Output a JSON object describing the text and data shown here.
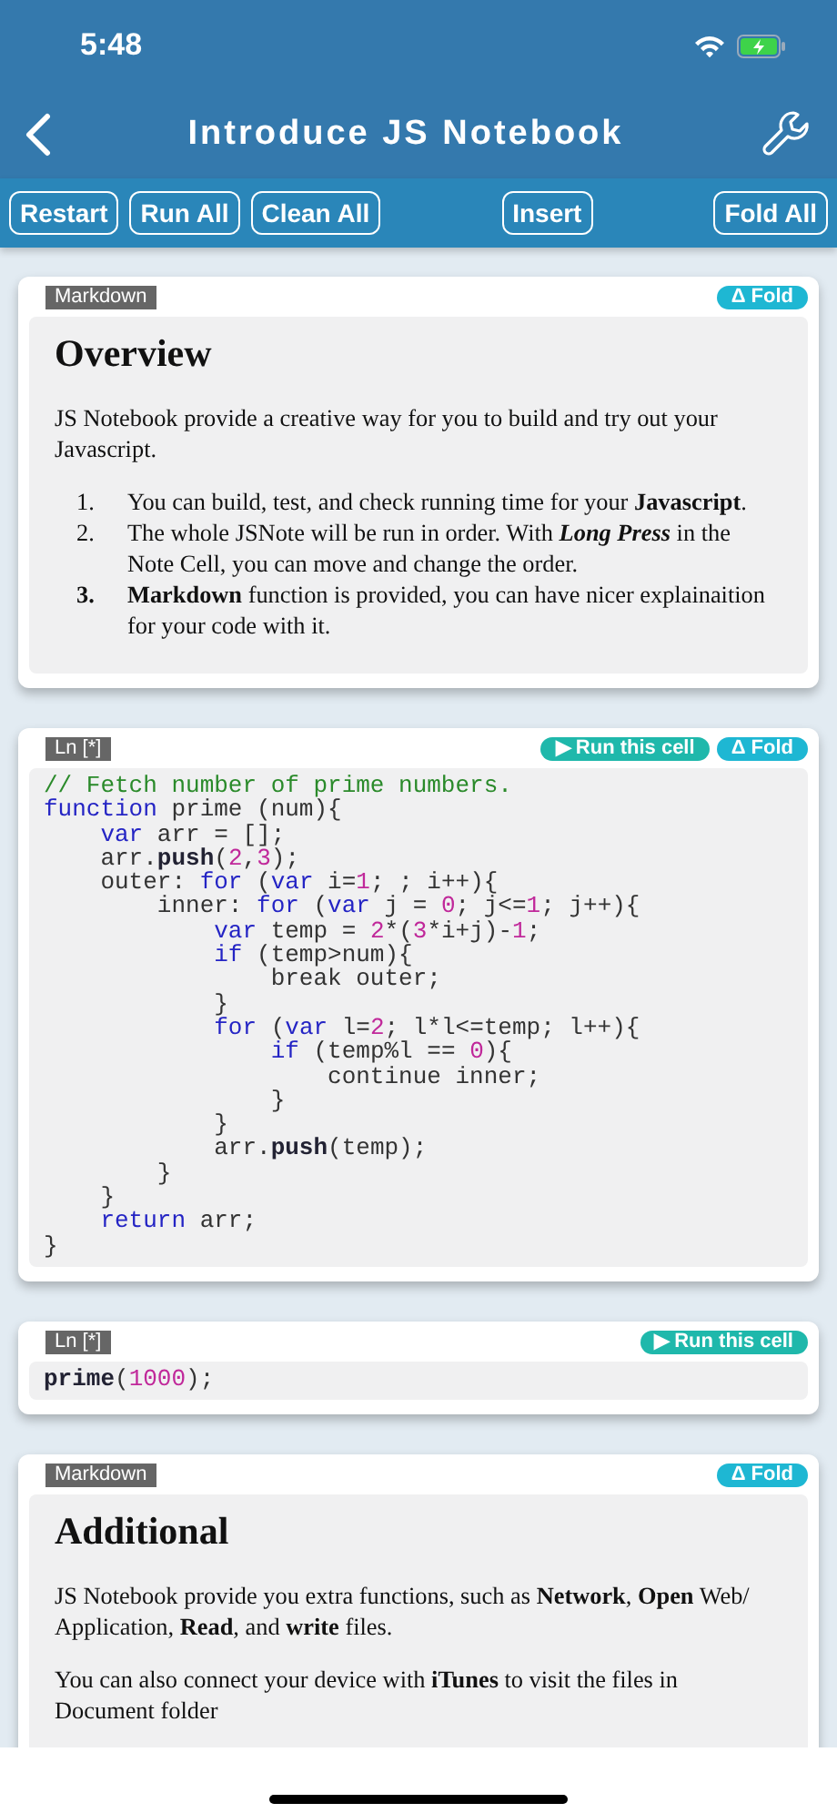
{
  "status_bar": {
    "time": "5:48"
  },
  "nav": {
    "title": "Introduce JS Notebook"
  },
  "toolbar": {
    "buttons": [
      {
        "label": "Restart",
        "kind": "left"
      },
      {
        "label": "Run All",
        "kind": "left"
      },
      {
        "label": "Clean All",
        "kind": "left"
      },
      {
        "label": "Insert",
        "kind": "center"
      },
      {
        "label": "Fold All",
        "kind": "right"
      }
    ]
  },
  "cells": [
    {
      "kind": "markdown",
      "tag": "Markdown",
      "buttons": [
        {
          "kind": "fold",
          "label": "Δ Fold"
        }
      ],
      "heading": "Overview",
      "paragraphs": [
        "JS Notebook provide a creative way for you to build and try out your Javascript."
      ],
      "list": [
        {
          "marker": "1.",
          "bold": false,
          "text": "You can build, test, and check running time for your **Javascript**."
        },
        {
          "marker": "2.",
          "bold": false,
          "text": "The whole JSNote will be run in order. With *Long Press* in the Note Cell, you can move and change the order."
        },
        {
          "marker": "3.",
          "bold": true,
          "text": "**Markdown** function is provided, you can have nicer explainaition for your code with it."
        }
      ]
    },
    {
      "kind": "code",
      "tag": "Ln [*]",
      "buttons": [
        {
          "kind": "run",
          "label": "▶ Run this cell"
        },
        {
          "kind": "fold",
          "label": "Δ Fold"
        }
      ],
      "lines": [
        {
          "tokens": [
            {
              "kind": "comment",
              "text": "// Fetch number of prime numbers."
            }
          ]
        },
        {
          "tokens": [
            {
              "kind": "keyword",
              "text": "function"
            },
            {
              "kind": "plain",
              "text": " prime (num){"
            }
          ]
        },
        {
          "tokens": [
            {
              "kind": "keyword",
              "text": "    var"
            },
            {
              "kind": "plain",
              "text": " arr = [];"
            }
          ]
        },
        {
          "tokens": [
            {
              "kind": "plain",
              "text": "    arr."
            },
            {
              "kind": "method",
              "text": "push"
            },
            {
              "kind": "plain",
              "text": "("
            },
            {
              "kind": "number",
              "text": "2"
            },
            {
              "kind": "plain",
              "text": ","
            },
            {
              "kind": "number",
              "text": "3"
            },
            {
              "kind": "plain",
              "text": ");"
            }
          ]
        },
        {
          "tokens": [
            {
              "kind": "plain",
              "text": "    outer: "
            },
            {
              "kind": "keyword",
              "text": "for"
            },
            {
              "kind": "plain",
              "text": " ("
            },
            {
              "kind": "keyword",
              "text": "var"
            },
            {
              "kind": "plain",
              "text": " i="
            },
            {
              "kind": "number",
              "text": "1"
            },
            {
              "kind": "plain",
              "text": "; ; i++){"
            }
          ]
        },
        {
          "tokens": [
            {
              "kind": "plain",
              "text": "        inner: "
            },
            {
              "kind": "keyword",
              "text": "for"
            },
            {
              "kind": "plain",
              "text": " ("
            },
            {
              "kind": "keyword",
              "text": "var"
            },
            {
              "kind": "plain",
              "text": " j = "
            },
            {
              "kind": "number",
              "text": "0"
            },
            {
              "kind": "plain",
              "text": "; j<="
            },
            {
              "kind": "number",
              "text": "1"
            },
            {
              "kind": "plain",
              "text": "; j++){"
            }
          ]
        },
        {
          "tokens": [
            {
              "kind": "keyword",
              "text": "            var"
            },
            {
              "kind": "plain",
              "text": " temp = "
            },
            {
              "kind": "number",
              "text": "2"
            },
            {
              "kind": "plain",
              "text": "*("
            },
            {
              "kind": "number",
              "text": "3"
            },
            {
              "kind": "plain",
              "text": "*i+j)-"
            },
            {
              "kind": "number",
              "text": "1"
            },
            {
              "kind": "plain",
              "text": ";"
            }
          ]
        },
        {
          "tokens": [
            {
              "kind": "keyword",
              "text": "            if"
            },
            {
              "kind": "plain",
              "text": " (temp>num){"
            }
          ]
        },
        {
          "tokens": [
            {
              "kind": "plain",
              "text": "                break outer;"
            }
          ]
        },
        {
          "tokens": [
            {
              "kind": "plain",
              "text": "            }"
            }
          ]
        },
        {
          "tokens": [
            {
              "kind": "keyword",
              "text": "            for"
            },
            {
              "kind": "plain",
              "text": " ("
            },
            {
              "kind": "keyword",
              "text": "var"
            },
            {
              "kind": "plain",
              "text": " l="
            },
            {
              "kind": "number",
              "text": "2"
            },
            {
              "kind": "plain",
              "text": "; l*l<=temp; l++){"
            }
          ]
        },
        {
          "tokens": [
            {
              "kind": "keyword",
              "text": "                if"
            },
            {
              "kind": "plain",
              "text": " (temp%l == "
            },
            {
              "kind": "number",
              "text": "0"
            },
            {
              "kind": "plain",
              "text": "){"
            }
          ]
        },
        {
          "tokens": [
            {
              "kind": "plain",
              "text": "                    continue inner;"
            }
          ]
        },
        {
          "tokens": [
            {
              "kind": "plain",
              "text": "                }"
            }
          ]
        },
        {
          "tokens": [
            {
              "kind": "plain",
              "text": "            }"
            }
          ]
        },
        {
          "tokens": [
            {
              "kind": "plain",
              "text": "            arr."
            },
            {
              "kind": "method",
              "text": "push"
            },
            {
              "kind": "plain",
              "text": "(temp);"
            }
          ]
        },
        {
          "tokens": [
            {
              "kind": "plain",
              "text": "        }"
            }
          ]
        },
        {
          "tokens": [
            {
              "kind": "plain",
              "text": "    }"
            }
          ]
        },
        {
          "tokens": [
            {
              "kind": "keyword",
              "text": "    return"
            },
            {
              "kind": "plain",
              "text": " arr;"
            }
          ]
        },
        {
          "tokens": [
            {
              "kind": "plain",
              "text": "}"
            }
          ]
        }
      ]
    },
    {
      "kind": "code",
      "tag": "Ln [*]",
      "buttons": [
        {
          "kind": "run",
          "label": "▶ Run this cell"
        }
      ],
      "lines": [
        {
          "tokens": [
            {
              "kind": "method",
              "text": "prime"
            },
            {
              "kind": "plain",
              "text": "("
            },
            {
              "kind": "number",
              "text": "1000"
            },
            {
              "kind": "plain",
              "text": ");"
            }
          ]
        }
      ]
    },
    {
      "kind": "markdown",
      "tag": "Markdown",
      "buttons": [
        {
          "kind": "fold",
          "label": "Δ Fold"
        }
      ],
      "heading": "Additional",
      "paragraphs": [
        "JS Notebook provide you extra functions, such as **Network**, **Open** Web/ Application, **Read**, and **write** files.",
        "You can also connect your device with **iTunes** to visit the files in Document folder"
      ]
    }
  ]
}
